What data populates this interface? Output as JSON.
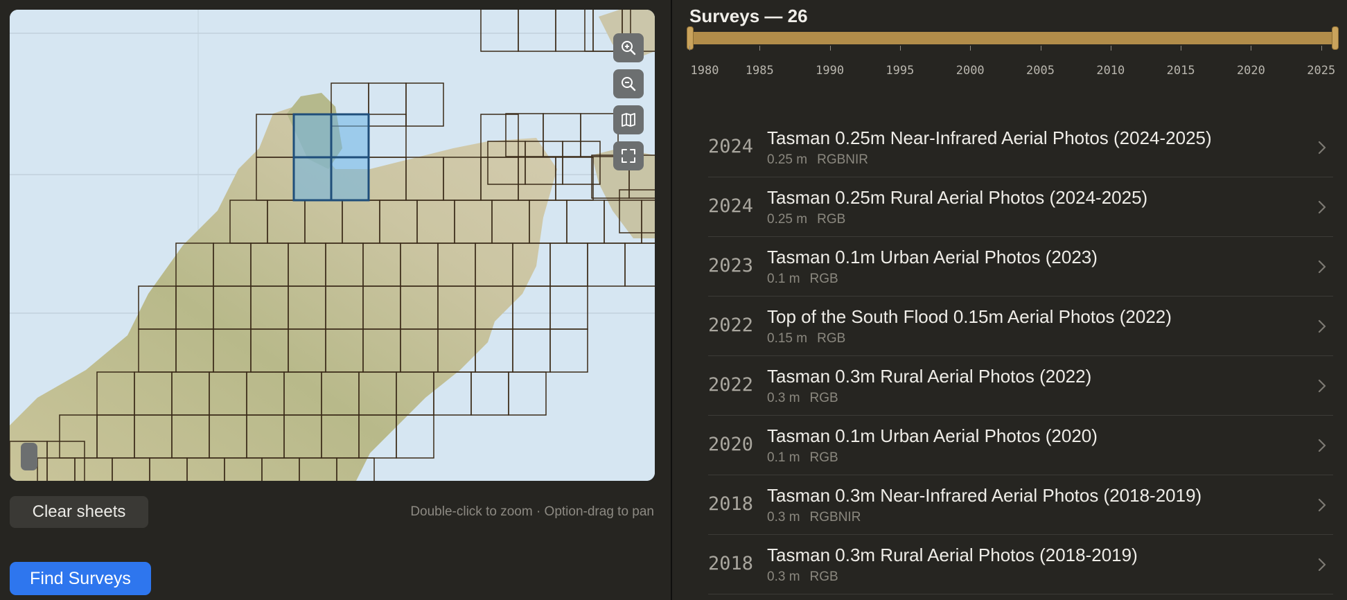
{
  "map": {
    "controls": [
      {
        "name": "zoom-in-button",
        "icon": "zoom-in-icon"
      },
      {
        "name": "zoom-out-button",
        "icon": "zoom-out-icon"
      },
      {
        "name": "map-layers-button",
        "icon": "map-icon"
      },
      {
        "name": "fullscreen-button",
        "icon": "fullscreen-icon"
      }
    ],
    "hint": "Double-click to zoom · Option-drag to pan"
  },
  "actions": {
    "clear_label": "Clear sheets",
    "find_label": "Find Surveys"
  },
  "surveys": {
    "title": "Surveys — 26",
    "ticks": [
      "1980",
      "1985",
      "1990",
      "1995",
      "2000",
      "2005",
      "2010",
      "2015",
      "2020",
      "2025"
    ],
    "range": {
      "min": 1980,
      "max": 2026
    },
    "items": [
      {
        "year": "2024",
        "title": "Tasman 0.25m Near-Infrared Aerial Photos (2024-2025)",
        "resolution": "0.25 m",
        "bands": "RGBNIR"
      },
      {
        "year": "2024",
        "title": "Tasman 0.25m Rural Aerial Photos (2024-2025)",
        "resolution": "0.25 m",
        "bands": "RGB"
      },
      {
        "year": "2023",
        "title": "Tasman 0.1m Urban Aerial Photos (2023)",
        "resolution": "0.1 m",
        "bands": "RGB"
      },
      {
        "year": "2022",
        "title": "Top of the South Flood 0.15m Aerial Photos (2022)",
        "resolution": "0.15 m",
        "bands": "RGB"
      },
      {
        "year": "2022",
        "title": "Tasman 0.3m Rural Aerial Photos (2022)",
        "resolution": "0.3 m",
        "bands": "RGB"
      },
      {
        "year": "2020",
        "title": "Tasman 0.1m Urban Aerial Photos (2020)",
        "resolution": "0.1 m",
        "bands": "RGB"
      },
      {
        "year": "2018",
        "title": "Tasman 0.3m Near-Infrared Aerial Photos (2018-2019)",
        "resolution": "0.3 m",
        "bands": "RGBNIR"
      },
      {
        "year": "2018",
        "title": "Tasman 0.3m Rural Aerial Photos (2018-2019)",
        "resolution": "0.3 m",
        "bands": "RGB"
      }
    ]
  },
  "colors": {
    "accent": "#2e76ee",
    "range": "#b28d4a",
    "background": "#262521"
  }
}
